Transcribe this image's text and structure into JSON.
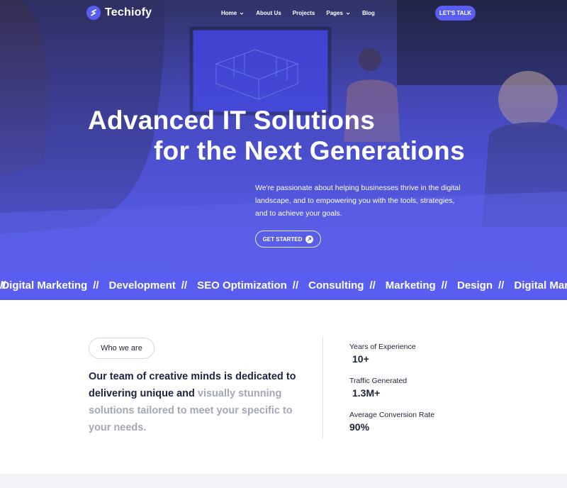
{
  "brand": {
    "name": "Techiofy",
    "accent": "#5a5ef0"
  },
  "nav": {
    "items": [
      {
        "label": "Home",
        "has_dropdown": true
      },
      {
        "label": "About Us",
        "has_dropdown": false
      },
      {
        "label": "Projects",
        "has_dropdown": false
      },
      {
        "label": "Pages",
        "has_dropdown": true
      },
      {
        "label": "Blog",
        "has_dropdown": false
      }
    ],
    "cta_label": "LET'S TALK"
  },
  "hero": {
    "headline_line1": "Advanced IT Solutions",
    "headline_line2": "for the Next Generations",
    "description": "We're passionate about helping businesses thrive in the digital landscape, and to empowering you with the tools, strategies, and  to achieve your goals.",
    "button_label": "GET STARTED"
  },
  "ticker": {
    "separator": "//",
    "items": [
      "Digital Marketing",
      "Development",
      "SEO Optimization",
      "Consulting",
      "Marketing",
      "Design",
      "Digital Marketing"
    ]
  },
  "about": {
    "pill_label": "Who we are",
    "text_dark": "Our team of creative minds is  dedicated to delivering unique and ",
    "text_muted": "visually stunning solutions tailored to meet your specific to your needs."
  },
  "stats": [
    {
      "label": "Years of Experience",
      "value": "10+"
    },
    {
      "label": "Traffic Generated",
      "value": "1.3M+"
    },
    {
      "label": "Average Conversion Rate",
      "value": "90%"
    }
  ]
}
